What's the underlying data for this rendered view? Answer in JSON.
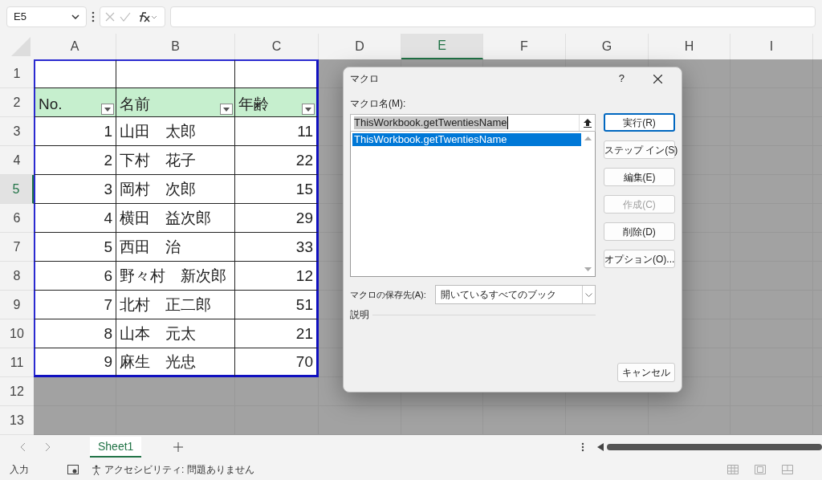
{
  "name_box": "E5",
  "columns": [
    {
      "label": "A",
      "selected": false
    },
    {
      "label": "B",
      "selected": false
    },
    {
      "label": "C",
      "selected": false
    },
    {
      "label": "D",
      "selected": false
    },
    {
      "label": "E",
      "selected": true
    },
    {
      "label": "F",
      "selected": false
    },
    {
      "label": "G",
      "selected": false
    },
    {
      "label": "H",
      "selected": false
    },
    {
      "label": "I",
      "selected": false
    }
  ],
  "row_headers": [
    {
      "label": "1",
      "selected": false
    },
    {
      "label": "2",
      "selected": false
    },
    {
      "label": "3",
      "selected": false
    },
    {
      "label": "4",
      "selected": false
    },
    {
      "label": "5",
      "selected": true
    },
    {
      "label": "6",
      "selected": false
    },
    {
      "label": "7",
      "selected": false
    },
    {
      "label": "8",
      "selected": false
    },
    {
      "label": "9",
      "selected": false
    },
    {
      "label": "10",
      "selected": false
    },
    {
      "label": "11",
      "selected": false
    },
    {
      "label": "12",
      "selected": false
    },
    {
      "label": "13",
      "selected": false
    }
  ],
  "table": {
    "headers": [
      "No.",
      "名前",
      "年齢"
    ],
    "rows": [
      [
        "1",
        "山田　太郎",
        "11"
      ],
      [
        "2",
        "下村　花子",
        "22"
      ],
      [
        "3",
        "岡村　次郎",
        "15"
      ],
      [
        "4",
        "横田　益次郎",
        "29"
      ],
      [
        "5",
        "西田　治",
        "33"
      ],
      [
        "6",
        "野々村　新次郎",
        "12"
      ],
      [
        "7",
        "北村　正二郎",
        "51"
      ],
      [
        "8",
        "山本　元太",
        "21"
      ],
      [
        "9",
        "麻生　光忠",
        "70"
      ]
    ]
  },
  "dialog": {
    "title": "マクロ",
    "help": "?",
    "name_label": "マクロ名(M):",
    "name_value": "ThisWorkbook.getTwentiesName",
    "list": [
      {
        "label": "ThisWorkbook.getTwentiesName",
        "selected": true
      }
    ],
    "buttons": [
      {
        "label": "実行(R)",
        "disabled": false,
        "default": true
      },
      {
        "label": "ステップ イン(S)",
        "disabled": false,
        "default": false
      },
      {
        "label": "編集(E)",
        "disabled": false,
        "default": false
      },
      {
        "label": "作成(C)",
        "disabled": true,
        "default": false
      },
      {
        "label": "削除(D)",
        "disabled": false,
        "default": false
      },
      {
        "label": "オプション(O)...",
        "disabled": false,
        "default": false
      }
    ],
    "store_label": "マクロの保存先(A):",
    "store_value": "開いているすべてのブック",
    "description_label": "説明",
    "cancel": "キャンセル"
  },
  "sheet_tabs": [
    {
      "label": "Sheet1",
      "selected": true
    }
  ],
  "status_bar": {
    "mode": "入力",
    "accessibility": "アクセシビリティ: 問題ありません"
  }
}
